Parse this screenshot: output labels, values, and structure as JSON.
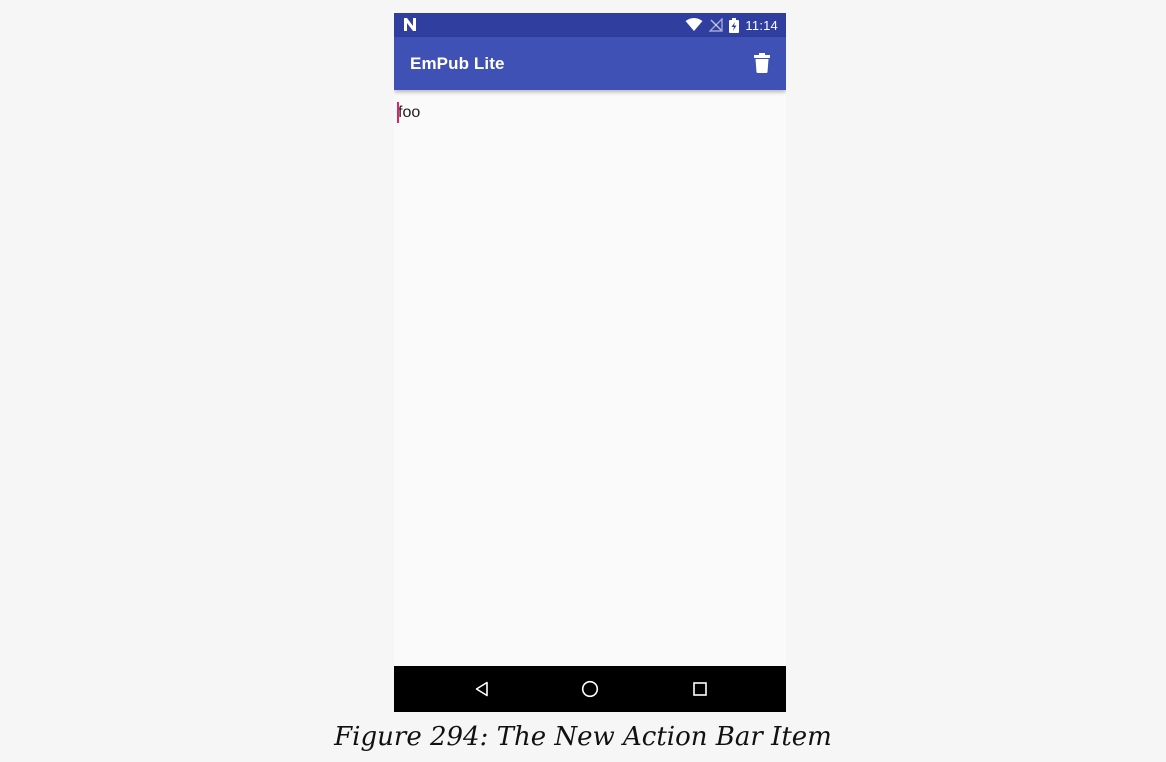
{
  "status_bar": {
    "notification_icon": "n-icon",
    "wifi_icon": "wifi-icon",
    "signal_icon": "no-signal-icon",
    "battery_icon": "battery-charging-icon",
    "time": "11:14"
  },
  "app_bar": {
    "title": "EmPub Lite",
    "action_icon": "delete-icon"
  },
  "editor": {
    "value": "foo"
  },
  "nav_bar": {
    "back_icon": "back-icon",
    "home_icon": "home-icon",
    "recents_icon": "recents-icon"
  },
  "caption": "Figure 294: The New Action Bar Item",
  "colors": {
    "status_bar": "#303f9f",
    "app_bar": "#3f51b5",
    "accent": "#e91e63",
    "background": "#fafafa",
    "nav_bar": "#000000"
  }
}
